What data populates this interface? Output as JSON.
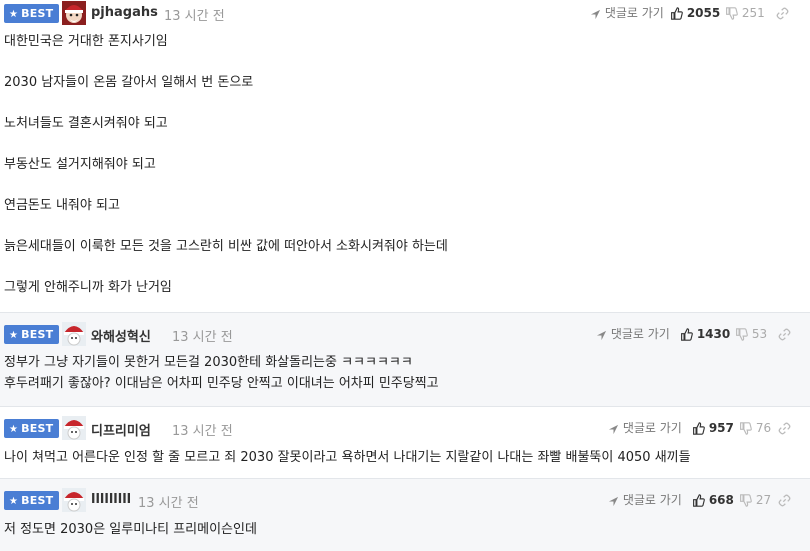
{
  "comments": [
    {
      "badge": "BEST",
      "nickname": "pjhagahs",
      "time": "13 시간 전",
      "reply": "댓글로 가기",
      "upvotes": "2055",
      "downvotes": "251",
      "lines": [
        "대한민국은 거대한 폰지사기임",
        "2030 남자들이 온몸 갈아서 일해서 번 돈으로",
        "노처녀들도 결혼시켜줘야 되고",
        "부동산도 설거지해줘야 되고",
        "연금돈도 내줘야 되고",
        "늙은세대들이 이룩한 모든 것을 고스란히 비싼 값에 떠안아서 소화시켜줘야 하는데",
        "그렇게 안해주니까 화가 난거임"
      ]
    },
    {
      "badge": "BEST",
      "nickname": "와해성혁신",
      "time": "13 시간 전",
      "reply": "댓글로 가기",
      "upvotes": "1430",
      "downvotes": "53",
      "lines": [
        "정부가 그냥 자기들이 못한거 모든걸 2030한테 화살돌리는중 ㅋㅋㅋㅋㅋㅋ",
        "후두려패기 좋잖아? 이대남은 어차피 민주당 안찍고 이대녀는 어차피 민주당찍고"
      ]
    },
    {
      "badge": "BEST",
      "nickname": "디프리미엄",
      "time": "13 시간 전",
      "reply": "댓글로 가기",
      "upvotes": "957",
      "downvotes": "76",
      "lines": [
        "나이 쳐먹고 어른다운 인정 할 줄 모르고 죄 2030 잘못이라고 욕하면서 나대기는 지랄같이 나대는 좌빨 배불뚝이 4050 새끼들"
      ]
    },
    {
      "badge": "BEST",
      "nickname": "lllllllll",
      "time": "13 시간 전",
      "reply": "댓글로 가기",
      "upvotes": "668",
      "downvotes": "27",
      "lines": [
        "저 정도면 2030은 일루미나티 프리메이슨인데"
      ]
    }
  ],
  "colors": {
    "badge": "#4a7ed4",
    "separator": "#e3e6ea",
    "muted": "#999999"
  }
}
